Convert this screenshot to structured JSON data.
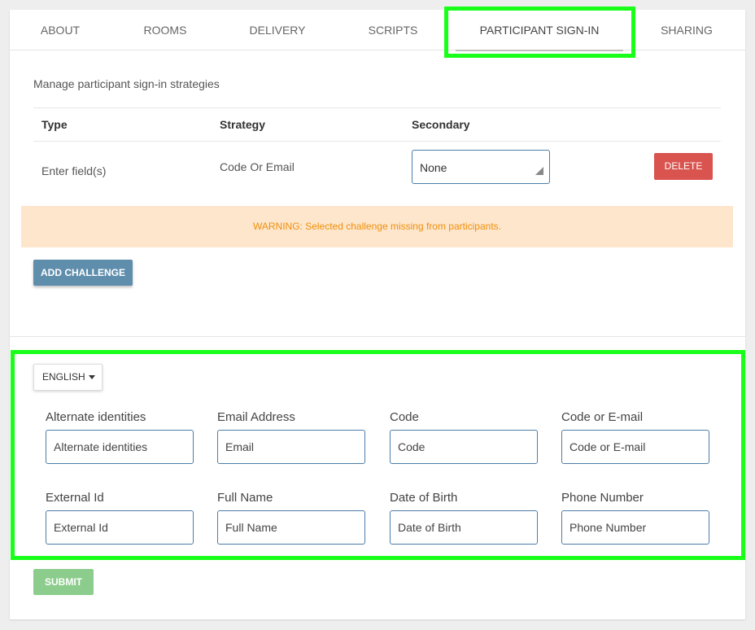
{
  "tabs": [
    {
      "label": "About"
    },
    {
      "label": "Rooms"
    },
    {
      "label": "Delivery"
    },
    {
      "label": "Scripts"
    },
    {
      "label": "Participant Sign-In",
      "active": true
    },
    {
      "label": "Sharing"
    }
  ],
  "intro": "Manage participant sign-in strategies",
  "table": {
    "headers": [
      "Type",
      "Strategy",
      "Secondary"
    ],
    "row": {
      "type": "Enter field(s)",
      "strategy": "Code Or Email",
      "secondary": "None",
      "delete_label": "Delete"
    }
  },
  "warning": "WARNING: Selected challenge missing from participants.",
  "add_challenge_label": "Add Challenge",
  "language": "ENGLISH",
  "fields": [
    {
      "label": "Alternate identities",
      "placeholder": "Alternate identities"
    },
    {
      "label": "Email Address",
      "placeholder": "Email"
    },
    {
      "label": "Code",
      "placeholder": "Code"
    },
    {
      "label": "Code or E-mail",
      "placeholder": "Code or E-mail"
    },
    {
      "label": "External Id",
      "placeholder": "External Id"
    },
    {
      "label": "Full Name",
      "placeholder": "Full Name"
    },
    {
      "label": "Date of Birth",
      "placeholder": "Date of Birth"
    },
    {
      "label": "Phone Number",
      "placeholder": "Phone Number"
    }
  ],
  "submit_label": "Submit",
  "colors": {
    "highlight": "#19ff19",
    "delete": "#d9534f",
    "add_challenge": "#5f8ead",
    "submit": "#8ccc8c",
    "warning_bg": "#fde6cc",
    "warning_text": "#f0900c",
    "input_border": "#4d7ca8"
  }
}
